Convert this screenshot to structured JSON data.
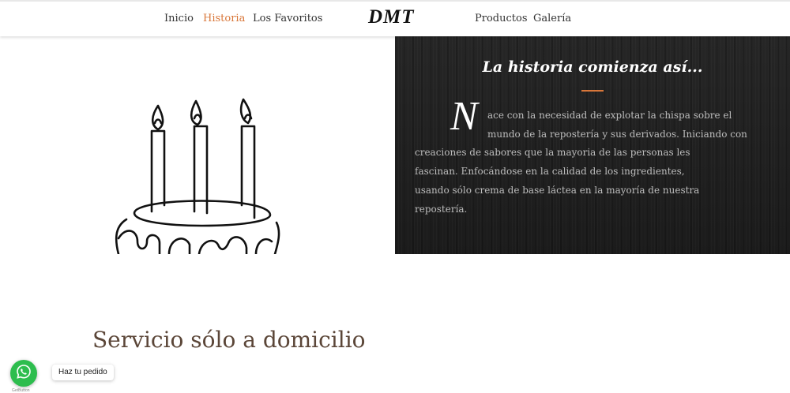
{
  "nav": {
    "left": [
      {
        "label": "Inicio",
        "active": false
      },
      {
        "label": "Historia",
        "active": true
      },
      {
        "label": "Los Favoritos",
        "active": false
      }
    ],
    "logo": "DMT",
    "right": [
      {
        "label": "Productos",
        "active": false
      },
      {
        "label": "Galería",
        "active": false
      }
    ],
    "active_color": "#d9773a"
  },
  "story": {
    "title": "La historia comienza así...",
    "dropcap": "N",
    "lines": [
      "ace con la necesidad de explotar la chispa sobre el",
      "mundo de la repostería y sus derivados. Iniciando con",
      "creaciones de sabores que la mayoria de las personas les",
      "fascinan. Enfocándose en la calidad de los ingredientes,",
      "usando sólo crema de base láctea en la mayoría de nuestra",
      "repostería."
    ]
  },
  "service": {
    "heading": "Servicio sólo a domicilio"
  },
  "whatsapp": {
    "icon": "whatsapp-icon",
    "tooltip": "Haz tu pedido",
    "credit": "GetButton",
    "color": "#2dbd4e"
  }
}
